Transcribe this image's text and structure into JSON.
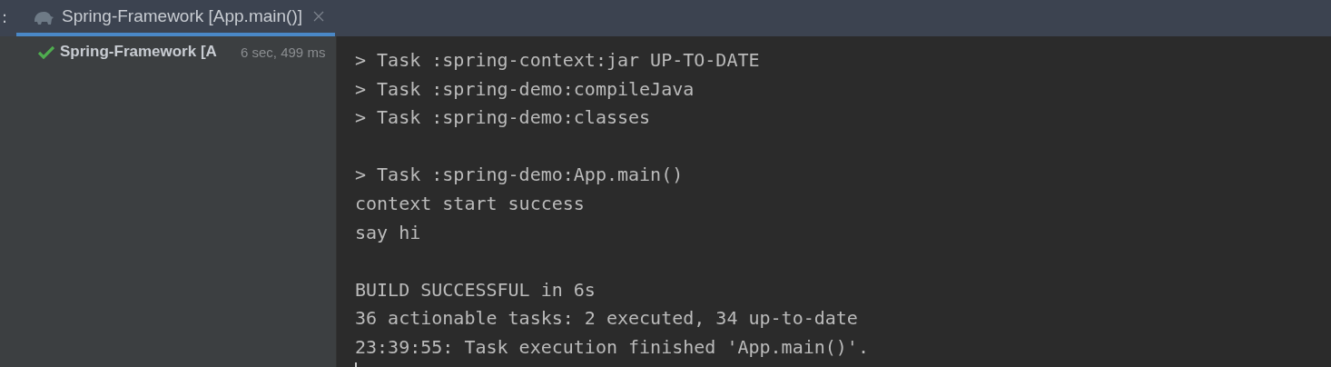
{
  "tab_bar": {
    "overflow_mark": ":",
    "tabs": [
      {
        "label": "Spring-Framework [App.main()]",
        "selected": true,
        "closable": true
      }
    ]
  },
  "run_tree": {
    "items": [
      {
        "kind": "success",
        "label": "Spring-Framework [A",
        "duration": "6 sec, 499 ms"
      }
    ]
  },
  "console": {
    "blocks": [
      [
        "> Task :spring-context:jar UP-TO-DATE",
        "> Task :spring-demo:compileJava",
        "> Task :spring-demo:classes"
      ],
      [
        "> Task :spring-demo:App.main()",
        "context start success",
        "say hi"
      ],
      [
        "BUILD SUCCESSFUL in 6s",
        "36 actionable tasks: 2 executed, 34 up-to-date",
        "23:39:55: Task execution finished 'App.main()'."
      ]
    ]
  }
}
